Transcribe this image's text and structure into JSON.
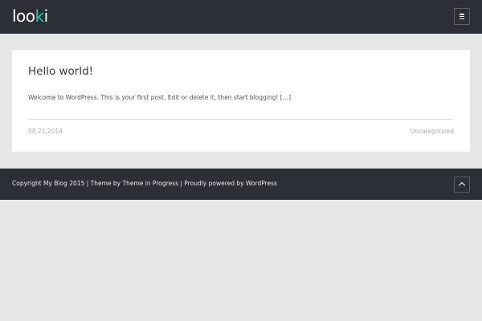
{
  "header": {
    "logo": {
      "prefix": "loo",
      "accent": "k",
      "suffix": "i"
    },
    "menu_icon": "menu-icon"
  },
  "post": {
    "title": "Hello world!",
    "excerpt": "Welcome to WordPress. This is your first post. Edit or delete it, then start blogging! […]",
    "date": "08.21.2014",
    "category": "Uncategorized"
  },
  "footer": {
    "credits": "Copyright My Blog 2015 | Theme by Theme in Progress | Proudly powered by WordPress",
    "back_to_top_icon": "chevron-up-icon"
  },
  "colors": {
    "header_bg": "#2c3036",
    "page_bg": "#e6e6e6",
    "card_bg": "#ffffff",
    "logo_accent": "#2ec4a6"
  }
}
